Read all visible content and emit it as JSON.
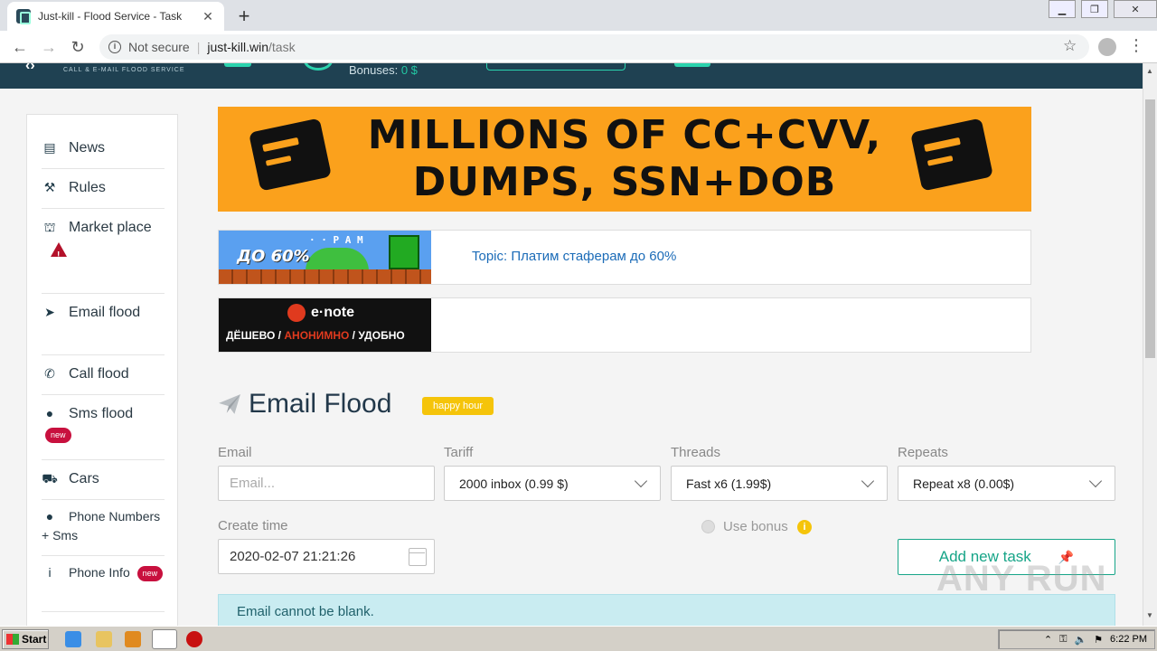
{
  "browser": {
    "tab_title": "Just-kill - Flood Service - Task",
    "not_secure": "Not secure",
    "url_host": "just-kill.win",
    "url_path": "/task"
  },
  "site_header": {
    "logo_sub": "CALL & E-MAIL FLOOD SERVICE",
    "bonuses_label": "Bonuses:",
    "bonuses_value": "0 $"
  },
  "sidebar": {
    "items": [
      {
        "label": "News",
        "icon": "newspaper-icon"
      },
      {
        "label": "Rules",
        "icon": "gavel-icon"
      },
      {
        "label": "Market place",
        "icon": "basket-icon"
      },
      {
        "label": "Email flood",
        "icon": "paper-plane-icon"
      },
      {
        "label": "Call flood",
        "icon": "phone-icon"
      },
      {
        "label": "Sms flood",
        "icon": "comments-icon",
        "badge": "new"
      },
      {
        "label": "Cars",
        "icon": "car-icon"
      },
      {
        "label": "Phone Numbers + Sms",
        "icon": "comments-icon"
      },
      {
        "label": "Phone Info",
        "icon": "info-icon",
        "badge": "new"
      }
    ]
  },
  "banner": {
    "line1": "MILLIONS OF CC+CVV,",
    "line2": "DUMPS, SSN+DOB"
  },
  "ads": {
    "ad1_text": "ДО 60%",
    "ad1_small": "· · Р А М",
    "ad1_link": "Topic: Платим стаферам до 60%",
    "ad2_logo": "e·note",
    "ad2_tag1": "ДЁШЕВО",
    "ad2_tag2": "АНОНИМНО",
    "ad2_tag3": "УДОБНО"
  },
  "form": {
    "title": "Email Flood",
    "happy_hour": "happy hour",
    "email_label": "Email",
    "email_placeholder": "Email...",
    "tariff_label": "Tariff",
    "tariff_value": "2000 inbox (0.99 $)",
    "threads_label": "Threads",
    "threads_value": "Fast x6 (1.99$)",
    "repeats_label": "Repeats",
    "repeats_value": "Repeat x8 (0.00$)",
    "create_time_label": "Create time",
    "create_time_value": "2020-02-07 21:21:26",
    "use_bonus": "Use bonus",
    "add_task": "Add new task",
    "alert": "Email cannot be blank."
  },
  "watermark": "ANY RUN",
  "taskbar": {
    "start": "Start",
    "time": "6:22 PM"
  }
}
